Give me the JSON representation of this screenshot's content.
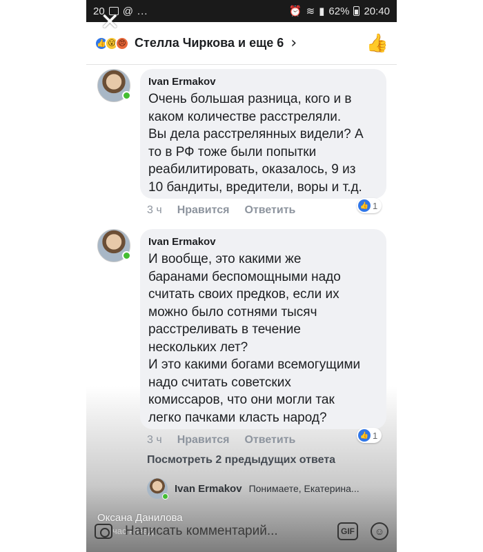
{
  "status_bar": {
    "time_short": "20",
    "battery": "62%",
    "clock": "20:40"
  },
  "header": {
    "title": "Стелла Чиркова и еще 6",
    "reactions": [
      "like-icon",
      "wow-icon",
      "angry-icon"
    ],
    "chevron": "›"
  },
  "comments": [
    {
      "author": "Ivan Ermakov",
      "text": "Очень большая разница, кого и в\nкаком количестве расстреляли.\nВы дела расстрелянных видели? А\nто в РФ тоже были попытки\nреабилитировать, оказалось, 9 из\n10 бандиты, вредители, воры и т.д.",
      "time": "3 ч",
      "like_label": "Нравится",
      "reply_label": "Ответить",
      "reaction_count": "1"
    },
    {
      "author": "Ivan Ermakov",
      "text": "И вообще, это какими же\nбаранами беспомощными надо\nсчитать своих предков, если их\nможно было сотнями тысяч\nрасстреливать в течение\nнескольких лет?\nИ это какими богами всемогущими\nнадо считать советских\nкомиссаров, что они могли так\nлегко пачками класть народ?",
      "time": "3 ч",
      "like_label": "Нравится",
      "reply_label": "Ответить",
      "reaction_count": "1"
    }
  ],
  "view_previous": "Посмотреть 2 предыдущих ответа",
  "reply_preview": {
    "author": "Ivan Ermakov",
    "snippet": "Понимаете, Екатерина..."
  },
  "composer": {
    "placeholder": "Написать комментарий...",
    "gif_label": "GIF"
  },
  "overlay": {
    "caption": "Оксана Данилова",
    "sub": "час назад"
  },
  "colors": {
    "like_blue": "#2f76e8",
    "online_green": "#44bd32",
    "bubble_bg": "#f0f1f4"
  }
}
